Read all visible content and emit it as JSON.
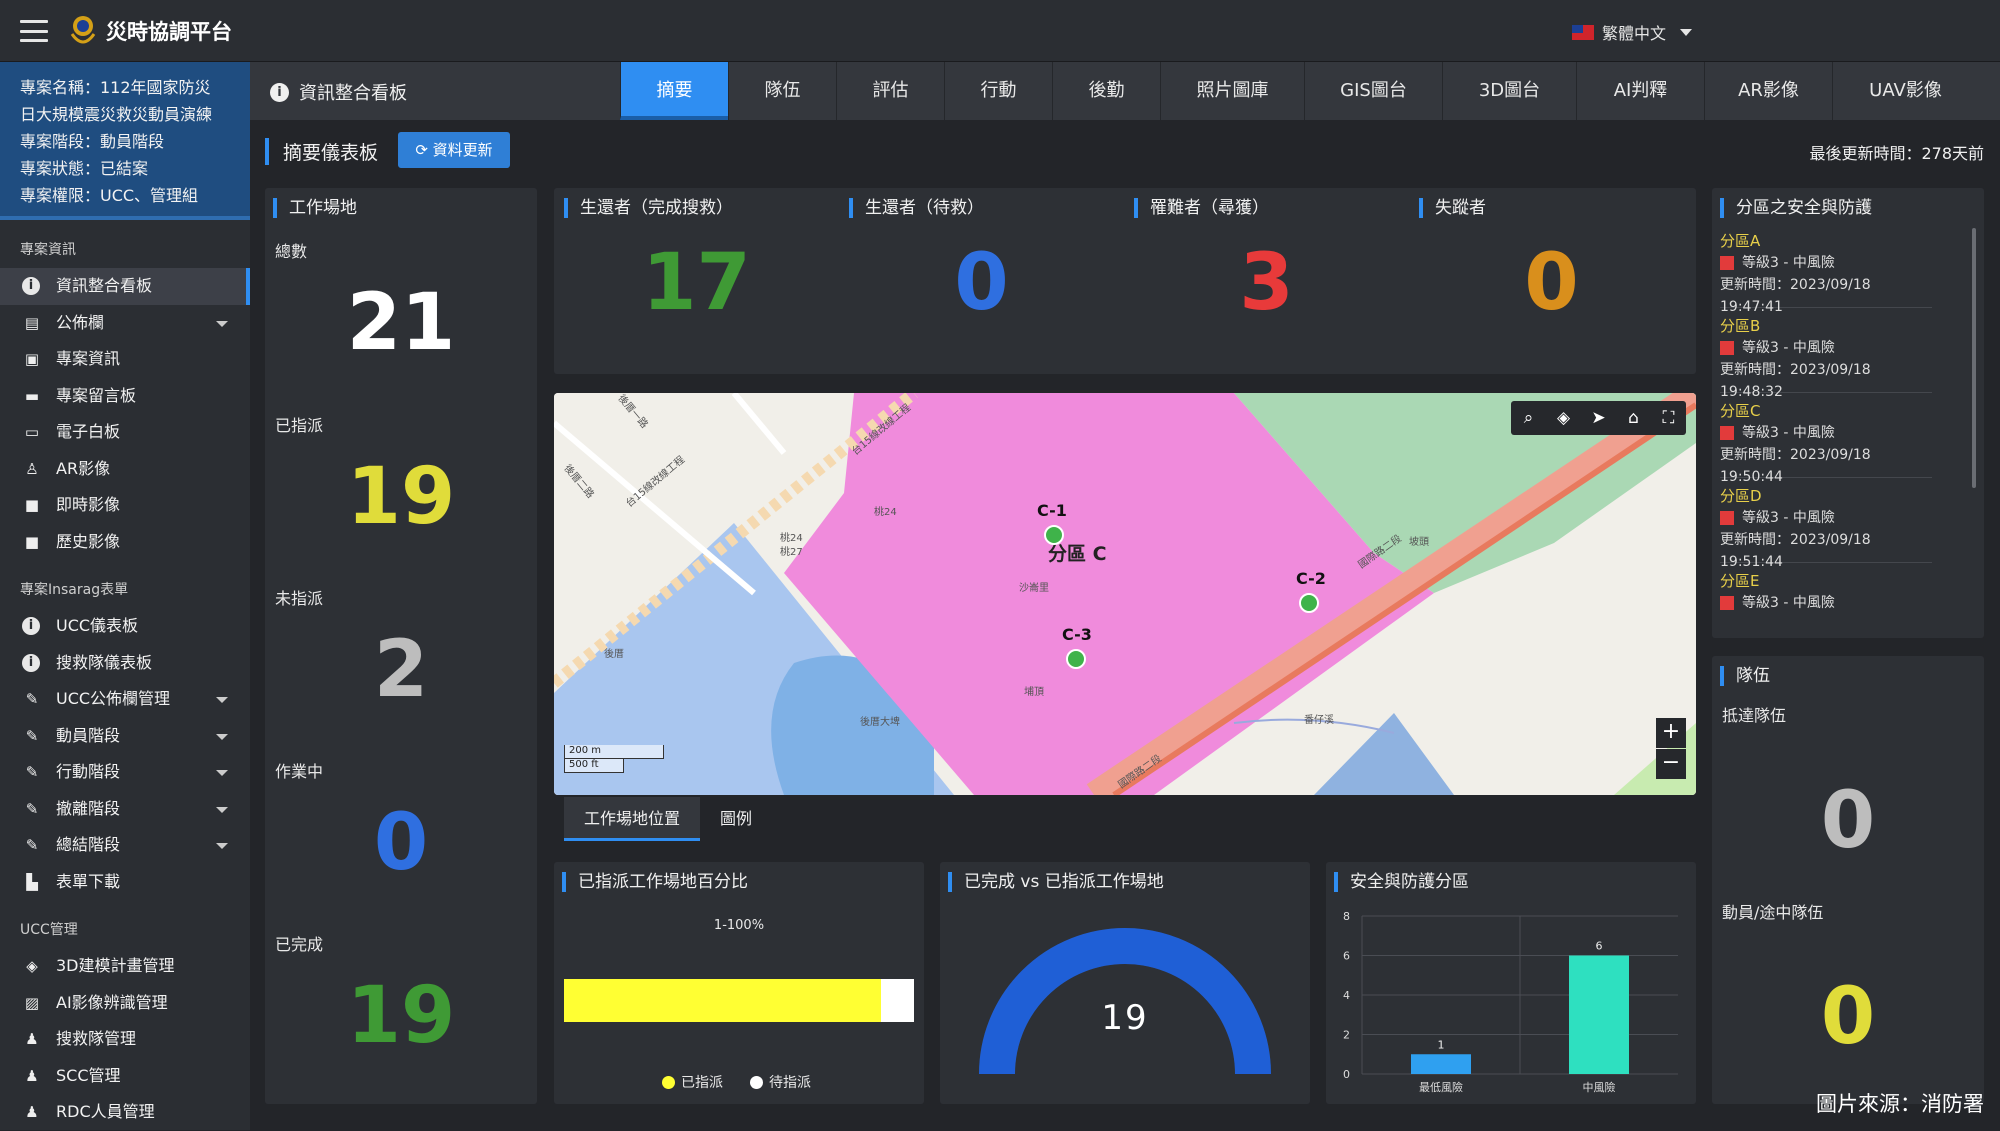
{
  "header": {
    "app_title": "災時協調平台",
    "language": "繁體中文"
  },
  "project": {
    "line1": "專案名稱：112年國家防災",
    "line2": "日大規模震災救災動員演練",
    "line3": "專案階段：動員階段",
    "line4": "專案狀態：已結案",
    "line5": "專案權限：UCC、管理組"
  },
  "sidebar": {
    "section1": "專案資訊",
    "items1": [
      {
        "label": "資訊整合看板"
      },
      {
        "label": "公佈欄"
      },
      {
        "label": "專案資訊"
      },
      {
        "label": "專案留言板"
      },
      {
        "label": "電子白板"
      },
      {
        "label": "AR影像"
      },
      {
        "label": "即時影像"
      },
      {
        "label": "歷史影像"
      }
    ],
    "section2": "專案Insarag表單",
    "items2": [
      {
        "label": "UCC儀表板"
      },
      {
        "label": "搜救隊儀表板"
      },
      {
        "label": "UCC公佈欄管理"
      },
      {
        "label": "動員階段"
      },
      {
        "label": "行動階段"
      },
      {
        "label": "撤離階段"
      },
      {
        "label": "總結階段"
      },
      {
        "label": "表單下載"
      }
    ],
    "section3": "UCC管理",
    "items3": [
      {
        "label": "3D建模計畫管理"
      },
      {
        "label": "AI影像辨識管理"
      },
      {
        "label": "搜救隊管理"
      },
      {
        "label": "SCC管理"
      },
      {
        "label": "RDC人員管理"
      }
    ]
  },
  "subheader": {
    "title": "資訊整合看板"
  },
  "tabs": [
    {
      "label": "摘要"
    },
    {
      "label": "隊伍"
    },
    {
      "label": "評估"
    },
    {
      "label": "行動"
    },
    {
      "label": "後勤"
    },
    {
      "label": "照片圖庫"
    },
    {
      "label": "GIS圖台"
    },
    {
      "label": "3D圖台"
    },
    {
      "label": "AI判釋"
    },
    {
      "label": "AR影像"
    },
    {
      "label": "UAV影像"
    }
  ],
  "dashboard": {
    "title": "摘要儀表板",
    "refresh_label": "資料更新",
    "last_updated": "最後更新時間：278天前"
  },
  "worksites": {
    "title": "工作場地",
    "total_label": "總數",
    "total": "21",
    "assigned_label": "已指派",
    "assigned": "19",
    "unassigned_label": "未指派",
    "unassigned": "2",
    "working_label": "作業中",
    "working": "0",
    "done_label": "已完成",
    "done": "19"
  },
  "stats": [
    {
      "label": "生還者（完成搜救）",
      "value": "17",
      "color": "#3f9a35"
    },
    {
      "label": "生還者（待救）",
      "value": "0",
      "color": "#2f6fe0"
    },
    {
      "label": "罹難者（尋獲）",
      "value": "3",
      "color": "#e83a3a"
    },
    {
      "label": "失蹤者",
      "value": "0",
      "color": "#d98f1c"
    }
  ],
  "map": {
    "markers": [
      "C-1",
      "C-2",
      "C-3"
    ],
    "zone_label": "分區 C",
    "scale_m": "200 m",
    "scale_ft": "500 ft",
    "roads": [
      "台15線改線工程",
      "台15線改線工程",
      "後厝一路",
      "後厝二路",
      "國際路二段",
      "國際路二段",
      "桃24",
      "桃24",
      "桃27",
      "沙崙里",
      "後厝",
      "埔頂",
      "後厝大埤",
      "番仔溪",
      "坡頭"
    ],
    "zoom_in": "+",
    "zoom_out": "−"
  },
  "map_tabs": [
    {
      "label": "工作場地位置"
    },
    {
      "label": "圖例"
    }
  ],
  "regions": {
    "title": "分區之安全與防護",
    "items": [
      {
        "name": "分區A",
        "level": "等級3 - 中風險",
        "time": "更新時間：2023/09/18 19:47:41"
      },
      {
        "name": "分區B",
        "level": "等級3 - 中風險",
        "time": "更新時間：2023/09/18 19:48:32"
      },
      {
        "name": "分區C",
        "level": "等級3 - 中風險",
        "time": "更新時間：2023/09/18 19:50:44"
      },
      {
        "name": "分區D",
        "level": "等級3 - 中風險",
        "time": "更新時間：2023/09/18 19:51:44"
      },
      {
        "name": "分區E",
        "level": "等級3 - 中風險"
      }
    ]
  },
  "teams": {
    "title": "隊伍",
    "arrived_label": "抵達隊伍",
    "arrived": "0",
    "mobilizing_label": "動員/途中隊伍",
    "mobilizing": "0"
  },
  "chart_assigned_pct": {
    "title": "已指派工作場地百分比",
    "range_label": "1-100%",
    "legend_assigned": "已指派",
    "legend_pending": "待指派"
  },
  "chart_gauge": {
    "title": "已完成 vs 已指派工作場地",
    "value": "19"
  },
  "chart_safety": {
    "title": "安全與防護分區"
  },
  "chart_data": [
    {
      "type": "bar",
      "title": "已指派工作場地百分比",
      "series": [
        {
          "name": "已指派",
          "values": [
            19
          ]
        },
        {
          "name": "待指派",
          "values": [
            2
          ]
        }
      ],
      "colors": [
        "#ffff33",
        "#ffffff"
      ]
    },
    {
      "type": "gauge",
      "title": "已完成 vs 已指派工作場地",
      "value": 19,
      "max": 19
    },
    {
      "type": "bar",
      "title": "安全與防護分區",
      "categories": [
        "最低風險",
        "中風險"
      ],
      "values": [
        1,
        6
      ],
      "ylim": [
        0,
        8
      ],
      "yticks": [
        0,
        2,
        4,
        6,
        8
      ],
      "colors": [
        "#2fa0f0",
        "#2ee0c0"
      ]
    }
  ],
  "footer": {
    "source": "圖片來源：消防署"
  }
}
